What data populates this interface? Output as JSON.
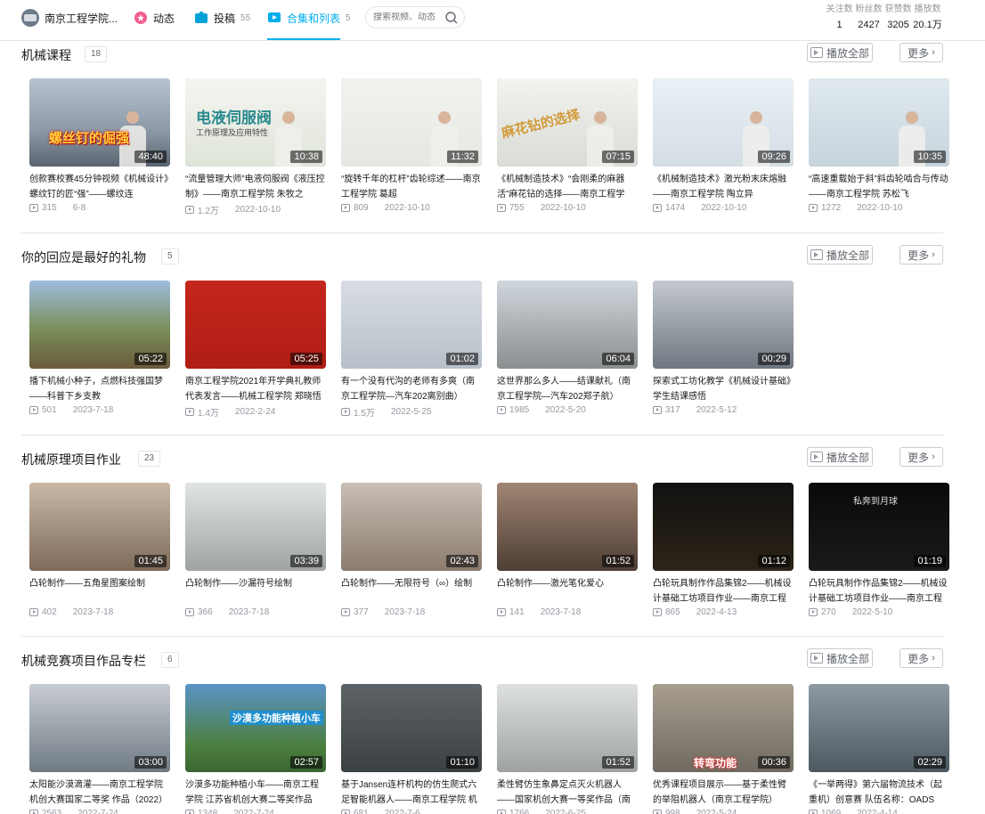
{
  "nav": {
    "channel_name": "南京工程学院...",
    "dynamics": "动态",
    "uploads": "投稿",
    "uploads_count": "55",
    "collections": "合集和列表",
    "collections_count": "5",
    "search_placeholder": "搜索视频、动态"
  },
  "stats": [
    {
      "label": "关注数",
      "value": "1"
    },
    {
      "label": "粉丝数",
      "value": "2427"
    },
    {
      "label": "获赞数",
      "value": "3205"
    },
    {
      "label": "播放数",
      "value": "20.1万"
    }
  ],
  "buttons": {
    "play_all": "播放全部",
    "more": "更多"
  },
  "sections": [
    {
      "title": "机械课程",
      "count": "18",
      "videos": [
        {
          "title": "创款赛校赛45分钟视频《机械设计》螺纹钉的匠“强”——螺纹连",
          "duration": "48:40",
          "views": "315",
          "date": "6-8",
          "thumb_text": "螺丝钉的倔强"
        },
        {
          "title": "“流量管理大师”电液伺服阀《液压控制》——南京工程学院 朱牧之",
          "duration": "10:38",
          "views": "1.2万",
          "date": "2022-10-10",
          "thumb_text": "电液伺服阀",
          "thumb_sub": "工作原理及应用特性"
        },
        {
          "title": "“旋转千年的杠杆”齿轮综述——南京工程学院 葛超",
          "duration": "11:32",
          "views": "809",
          "date": "2022-10-10"
        },
        {
          "title": "《机械制造技术》“会刚柔的麻器活”麻花钻的选择——南京工程学",
          "duration": "07:15",
          "views": "755",
          "date": "2022-10-10",
          "thumb_text": "麻花钻的选择"
        },
        {
          "title": "《机械制造技术》激光粉末床熔融——南京工程学院 陶立异",
          "duration": "09:26",
          "views": "1474",
          "date": "2022-10-10"
        },
        {
          "title": "“高速重载始于斜”斜齿轮啮合与传动——南京工程学院 苏松飞",
          "duration": "10:35",
          "views": "1272",
          "date": "2022-10-10"
        }
      ]
    },
    {
      "title": "你的回应是最好的礼物",
      "count": "5",
      "videos": [
        {
          "title": "播下机械小种子，点燃科技强国梦——科普下乡支教",
          "duration": "05:22",
          "views": "501",
          "date": "2023-7-18"
        },
        {
          "title": "南京工程学院2021年开学典礼教师代表发言——机械工程学院 郑晓悟",
          "duration": "05:25",
          "views": "1.4万",
          "date": "2022-2-24"
        },
        {
          "title": "有一个没有代沟的老师有多爽（南京工程学院—汽车202离别曲）",
          "duration": "01:02",
          "views": "1.5万",
          "date": "2022-5-25"
        },
        {
          "title": "这世界那么多人——结课献礼（南京工程学院—汽车202郑子航）",
          "duration": "06:04",
          "views": "1985",
          "date": "2022-5-20"
        },
        {
          "title": "探索式工坊化教学《机械设计基础》学生结课感悟",
          "duration": "00:29",
          "views": "317",
          "date": "2022-5-12"
        }
      ]
    },
    {
      "title": "机械原理项目作业",
      "count": "23",
      "videos": [
        {
          "title": "凸轮制作——五角星图案绘制",
          "duration": "01:45",
          "views": "402",
          "date": "2023-7-18"
        },
        {
          "title": "凸轮制作——沙漏符号绘制",
          "duration": "03:39",
          "views": "366",
          "date": "2023-7-18"
        },
        {
          "title": "凸轮制作——无限符号（∞）绘制",
          "duration": "02:43",
          "views": "377",
          "date": "2023-7-18"
        },
        {
          "title": "凸轮制作——激光笔化爱心",
          "duration": "01:52",
          "views": "141",
          "date": "2023-7-18"
        },
        {
          "title": "凸轮玩具制作作品集锦2——机械设计基础工坊项目作业——南京工程",
          "duration": "01:12",
          "views": "865",
          "date": "2022-4-13"
        },
        {
          "title": "凸轮玩具制作作品集锦2——机械设计基础工坊项目作业——南京工程",
          "duration": "01:19",
          "views": "270",
          "date": "2022-5-10",
          "thumb_text": "私奔到月球"
        }
      ]
    },
    {
      "title": "机械竞赛项目作品专栏",
      "count": "6",
      "videos": [
        {
          "title": "太阳能沙漠滴灌——南京工程学院 机创大赛国家二等奖 作品（2022）",
          "duration": "03:00",
          "views": "2563",
          "date": "2022-7-24"
        },
        {
          "title": "沙漠多功能种植小车——南京工程学院 江苏省机创大赛二等奖作品",
          "duration": "02:57",
          "views": "1348",
          "date": "2022-7-24",
          "thumb_text": "沙漠多功能种植小车"
        },
        {
          "title": "基于Jansen连杆机构的仿生爬式六足智能机器人——南京工程学院 机",
          "duration": "01:10",
          "views": "681",
          "date": "2022-7-6"
        },
        {
          "title": "柔性臂仿生象鼻定点灭火机器人——国家机创大赛一等奖作品（南",
          "duration": "01:52",
          "views": "1766",
          "date": "2022-6-25"
        },
        {
          "title": "优秀课程项目展示——基于柔性臂的举阻机器人（南京工程学院）",
          "duration": "00:36",
          "views": "998",
          "date": "2022-5-24",
          "thumb_text": "转弯功能"
        },
        {
          "title": "《一举两得》第六届物流技术（起重机）创意赛 队伍名称：OADS",
          "duration": "02:29",
          "views": "1069",
          "date": "2022-4-14"
        }
      ]
    }
  ]
}
